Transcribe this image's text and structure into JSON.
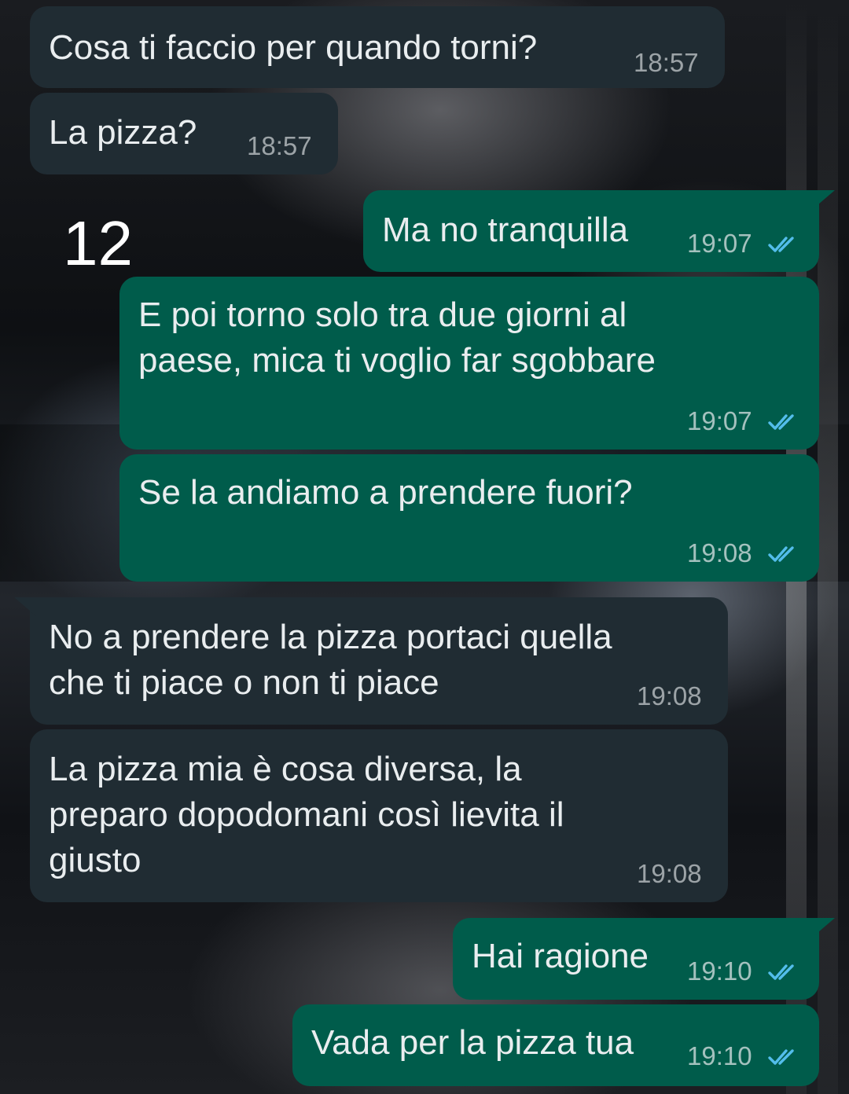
{
  "overlay_number": "12",
  "colors": {
    "incoming_bubble": "#202c33",
    "outgoing_bubble": "#005c4b",
    "text": "#e9edef",
    "read_ticks": "#53bdeb"
  },
  "icons": {
    "read_receipt": "double-check-icon"
  },
  "messages": [
    {
      "direction": "incoming",
      "text": "Cosa ti faccio per quando torni?",
      "time": "18:57"
    },
    {
      "direction": "incoming",
      "text": "La pizza?",
      "time": "18:57"
    },
    {
      "direction": "outgoing",
      "text": "Ma no tranquilla",
      "time": "19:07",
      "status": "read"
    },
    {
      "direction": "outgoing",
      "text": "E poi torno solo tra due giorni al\npaese, mica ti voglio far sgobbare",
      "time": "19:07",
      "status": "read"
    },
    {
      "direction": "outgoing",
      "text": "Se la andiamo a prendere fuori?",
      "time": "19:08",
      "status": "read"
    },
    {
      "direction": "incoming",
      "text": "No a prendere la pizza portaci quella\nche ti piace o non ti piace",
      "time": "19:08"
    },
    {
      "direction": "incoming",
      "text": "La pizza mia è cosa diversa, la\npreparo dopodomani così lievita il\ngiusto",
      "time": "19:08"
    },
    {
      "direction": "outgoing",
      "text": "Hai ragione",
      "time": "19:10",
      "status": "read"
    },
    {
      "direction": "outgoing",
      "text": "Vada per la pizza tua",
      "time": "19:10",
      "status": "read"
    }
  ]
}
